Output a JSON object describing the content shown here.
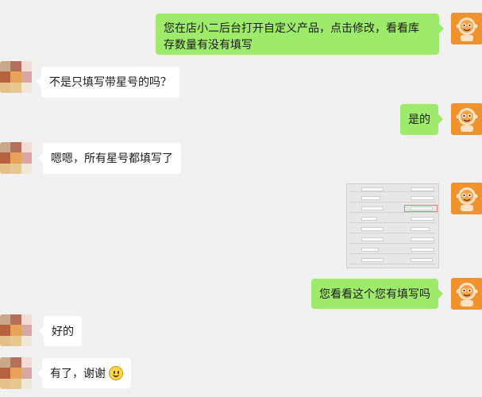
{
  "messages": [
    {
      "side": "right",
      "text": "您在店小二后台打开自定义产品，点击修改，看看库存数量有没有填写"
    },
    {
      "side": "left",
      "text": "不是只填写带星号的吗？"
    },
    {
      "side": "right",
      "text": "是的"
    },
    {
      "side": "left",
      "text": "嗯嗯，所有星号都填写了"
    },
    {
      "side": "right",
      "type": "image",
      "text": ""
    },
    {
      "side": "right",
      "text": "您看看这个您有填写吗"
    },
    {
      "side": "left",
      "text": "好的"
    },
    {
      "side": "left",
      "text": "有了，谢谢",
      "emoji": "smile-emoji"
    }
  ],
  "colors": {
    "background": "#f1f1f1",
    "sent_bubble": "#9eea6a",
    "received_bubble": "#ffffff",
    "agent_avatar": "#f0922e",
    "highlight_box": "#e27b7b"
  },
  "icons": {
    "agent_avatar": "robot-avatar-icon",
    "user_avatar": "blurred-avatar",
    "emoji": "smile-emoji"
  }
}
